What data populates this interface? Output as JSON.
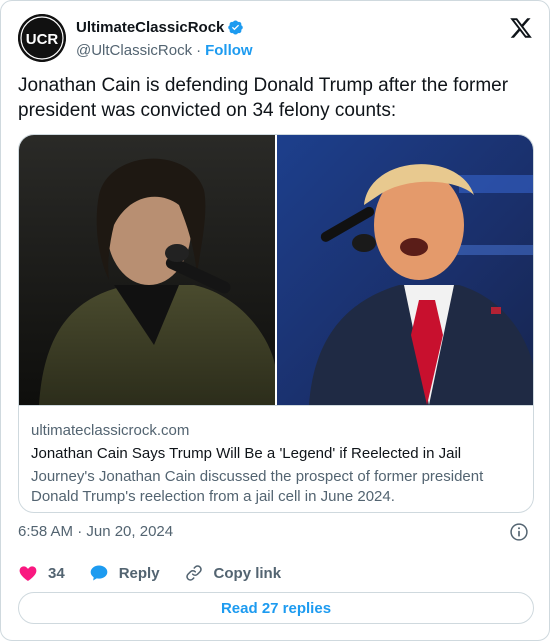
{
  "author": {
    "display_name": "UltimateClassicRock",
    "handle": "@UltClassicRock",
    "separator": "·",
    "follow_label": "Follow",
    "avatar_text": "UCR",
    "verified": true
  },
  "tweet": {
    "text": "Jonathan Cain is defending Donald Trump after the former president was convicted on 34 felony counts:",
    "timestamp": "6:58 AM · Jun 20, 2024"
  },
  "link_card": {
    "domain": "ultimateclassicrock.com",
    "title": "Jonathan Cain Says Trump Will Be a 'Legend' if Reelected in Jail",
    "description": "Journey's Jonathan Cain discussed the prospect of former president Donald Trump's reelection from a jail cell in June 2024."
  },
  "actions": {
    "likes": "34",
    "reply_label": "Reply",
    "copy_link_label": "Copy link"
  },
  "read_replies_label": "Read 27 replies",
  "colors": {
    "accent": "#1d9bf0",
    "like": "#f91880",
    "muted": "#536471",
    "text": "#0f1419",
    "border": "#cfd9de"
  }
}
